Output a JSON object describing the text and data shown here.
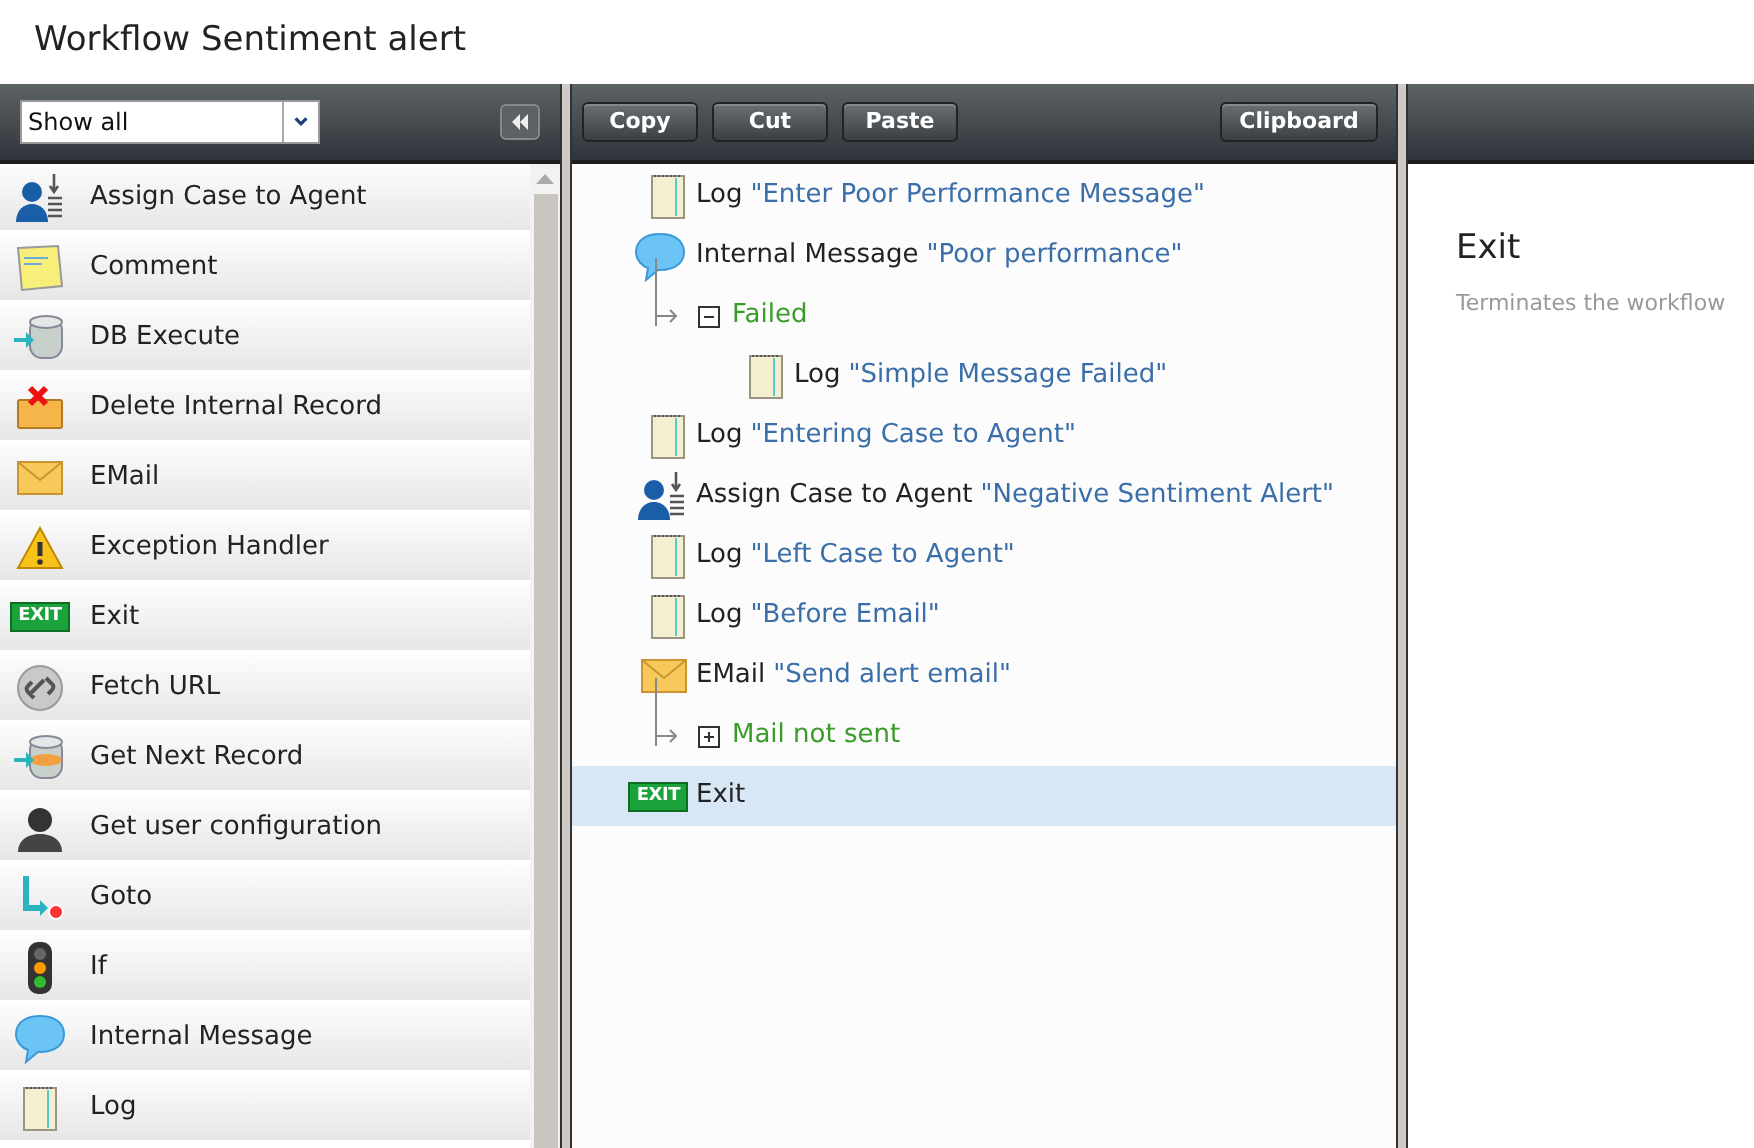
{
  "window": {
    "title": "Workflow Sentiment alert"
  },
  "palette": {
    "filter": {
      "value": "Show all"
    },
    "items": [
      {
        "kind": "assign",
        "label": "Assign Case to Agent"
      },
      {
        "kind": "comment",
        "label": "Comment"
      },
      {
        "kind": "db",
        "label": "DB Execute"
      },
      {
        "kind": "delete",
        "label": "Delete Internal Record"
      },
      {
        "kind": "email",
        "label": "EMail"
      },
      {
        "kind": "warning",
        "label": "Exception Handler"
      },
      {
        "kind": "exit",
        "icon_text": "EXIT",
        "label": "Exit"
      },
      {
        "kind": "link",
        "label": "Fetch URL"
      },
      {
        "kind": "dbnext",
        "label": "Get Next Record"
      },
      {
        "kind": "user",
        "label": "Get user configuration"
      },
      {
        "kind": "goto",
        "label": "Goto"
      },
      {
        "kind": "light",
        "label": "If"
      },
      {
        "kind": "bubble",
        "label": "Internal Message"
      },
      {
        "kind": "log",
        "label": "Log"
      }
    ]
  },
  "toolbar": {
    "buttons": [
      "Copy",
      "Cut",
      "Paste"
    ],
    "clipboard": "Clipboard"
  },
  "workflow": [
    {
      "kind": "log",
      "label": "Log",
      "detail": "\"Enter Poor Performance Message\"",
      "selected": false
    },
    {
      "kind": "bubble",
      "label": "Internal Message",
      "detail": "\"Poor performance\"",
      "selected": false,
      "children": [
        {
          "kind": "branch",
          "label": "Failed",
          "expanded": true,
          "children": [
            {
              "kind": "log",
              "label": "Log",
              "detail": "\"Simple Message Failed\"",
              "selected": false
            }
          ]
        }
      ]
    },
    {
      "kind": "log",
      "label": "Log",
      "detail": "\"Entering Case to Agent\"",
      "selected": false
    },
    {
      "kind": "assign",
      "label": "Assign Case to Agent",
      "detail": "\"Negative Sentiment Alert\"",
      "selected": false
    },
    {
      "kind": "log",
      "label": "Log",
      "detail": "\"Left Case to Agent\"",
      "selected": false
    },
    {
      "kind": "log",
      "label": "Log",
      "detail": "\"Before Email\"",
      "selected": false
    },
    {
      "kind": "email",
      "label": "EMail",
      "detail": "\"Send alert email\"",
      "selected": false,
      "children": [
        {
          "kind": "branch",
          "label": "Mail not sent",
          "expanded": false
        }
      ]
    },
    {
      "kind": "exit",
      "icon_text": "EXIT",
      "label": "Exit",
      "selected": true
    }
  ],
  "details": {
    "title": "Exit",
    "description": "Terminates the workflow"
  }
}
